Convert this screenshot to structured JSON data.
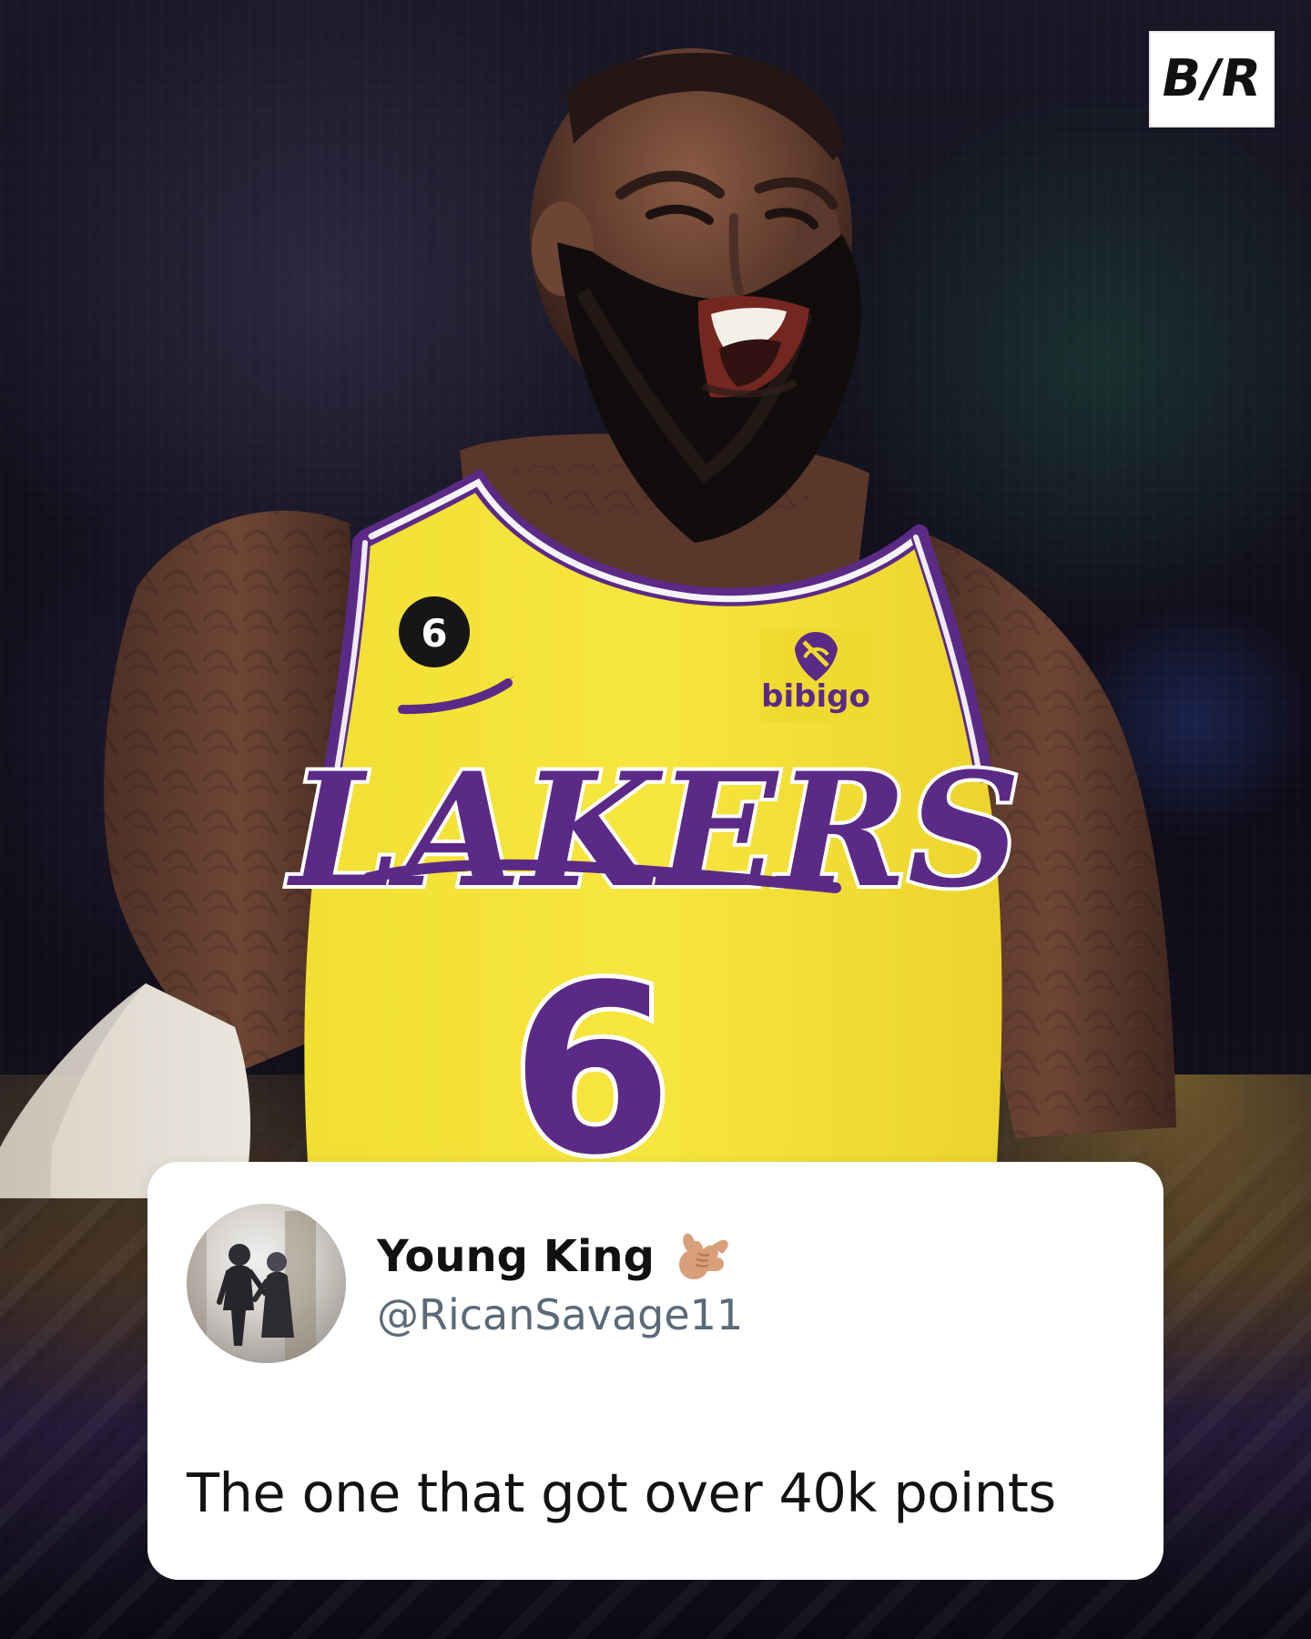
{
  "brand": {
    "logo_text": "B/R"
  },
  "jersey": {
    "patch_number": "6",
    "sponsor": "bibigo",
    "team": "LAKERS",
    "number": "6"
  },
  "tweet": {
    "display_name": "Young King",
    "handle": "@RicanSavage11",
    "text": "The one that got over 40k points"
  },
  "colors": {
    "jersey_yellow": "#F4E12F",
    "jersey_purple": "#5B2A86",
    "card_bg": "#FFFFFF",
    "handle_gray": "#5A6A78"
  },
  "icons": {
    "avatar": "couple-photo-avatar",
    "emoji": "call-me-hand-icon"
  }
}
